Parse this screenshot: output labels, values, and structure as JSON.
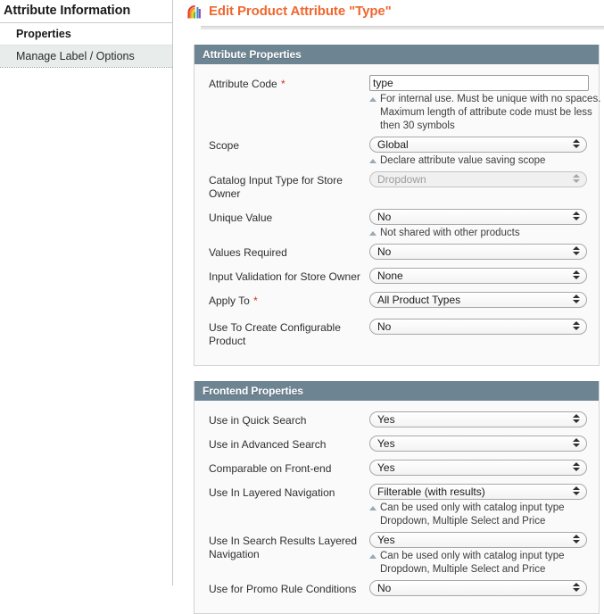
{
  "sidebar": {
    "title": "Attribute Information",
    "items": [
      {
        "label": "Properties",
        "active": true
      },
      {
        "label": "Manage Label / Options",
        "active": false
      }
    ]
  },
  "header": {
    "icon": "rainbow-attribute-icon",
    "title": "Edit Product Attribute \"Type\""
  },
  "colors": {
    "accent_orange": "#ef672f",
    "section_header": "#6d8492",
    "required_red": "#d1331f",
    "note_triangle": "#9aa9b3"
  },
  "sections": [
    {
      "id": "attribute-properties",
      "title": "Attribute Properties",
      "rows": [
        {
          "id": "attribute-code",
          "label": "Attribute Code",
          "required": true,
          "control": "text",
          "value": "type",
          "placeholder": "",
          "notes": [
            "For internal use. Must be unique with no spaces. Maximum length of attribute code must be less then 30 symbols"
          ]
        },
        {
          "id": "scope",
          "label": "Scope",
          "required": false,
          "control": "select",
          "value": "Global",
          "disabled": false,
          "notes": [
            "Declare attribute value saving scope"
          ]
        },
        {
          "id": "catalog-input-type",
          "label": "Catalog Input Type for Store Owner",
          "required": false,
          "control": "select",
          "value": "Dropdown",
          "disabled": true,
          "notes": []
        },
        {
          "id": "unique-value",
          "label": "Unique Value",
          "required": false,
          "control": "select",
          "value": "No",
          "disabled": false,
          "notes": [
            "Not shared with other products"
          ]
        },
        {
          "id": "values-required",
          "label": "Values Required",
          "required": false,
          "control": "select",
          "value": "No",
          "disabled": false,
          "notes": []
        },
        {
          "id": "input-validation",
          "label": "Input Validation for Store Owner",
          "required": false,
          "control": "select",
          "value": "None",
          "disabled": false,
          "notes": []
        },
        {
          "id": "apply-to",
          "label": "Apply To",
          "required": true,
          "control": "select",
          "value": "All Product Types",
          "disabled": false,
          "notes": []
        },
        {
          "id": "use-to-create-configurable-product",
          "label": "Use To Create Configurable Product",
          "required": false,
          "control": "select",
          "value": "No",
          "disabled": false,
          "notes": []
        }
      ]
    },
    {
      "id": "frontend-properties",
      "title": "Frontend Properties",
      "rows": [
        {
          "id": "use-in-quick-search",
          "label": "Use in Quick Search",
          "required": false,
          "control": "select",
          "value": "Yes",
          "disabled": false,
          "notes": []
        },
        {
          "id": "use-in-advanced-search",
          "label": "Use in Advanced Search",
          "required": false,
          "control": "select",
          "value": "Yes",
          "disabled": false,
          "notes": []
        },
        {
          "id": "comparable-on-front-end",
          "label": "Comparable on Front-end",
          "required": false,
          "control": "select",
          "value": "Yes",
          "disabled": false,
          "notes": []
        },
        {
          "id": "use-in-layered-navigation",
          "label": "Use In Layered Navigation",
          "required": false,
          "control": "select",
          "value": "Filterable (with results)",
          "disabled": false,
          "notes": [
            "Can be used only with catalog input type Dropdown, Multiple Select and Price"
          ]
        },
        {
          "id": "use-in-search-results-layered-navigation",
          "label": "Use In Search Results Layered Navigation",
          "required": false,
          "control": "select",
          "value": "Yes",
          "disabled": false,
          "notes": [
            "Can be used only with catalog input type Dropdown, Multiple Select and Price"
          ]
        },
        {
          "id": "use-for-promo-rule-conditions",
          "label": "Use for Promo Rule Conditions",
          "required": false,
          "control": "select",
          "value": "No",
          "disabled": false,
          "notes": []
        }
      ]
    }
  ]
}
